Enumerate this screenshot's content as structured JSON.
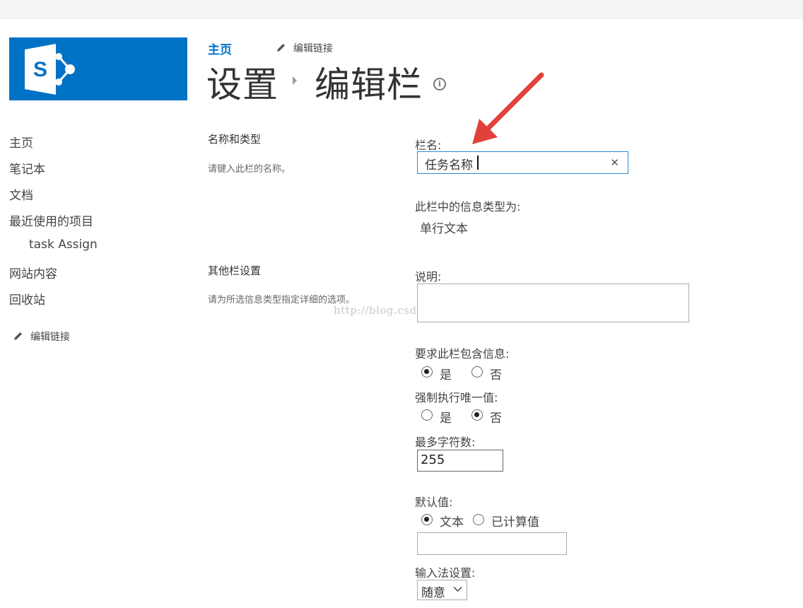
{
  "header": {
    "home_link": "主页",
    "edit_links": "编辑链接",
    "title_parent": "设置",
    "title_current": "编辑栏"
  },
  "logo": {
    "letter": "S"
  },
  "quick_launch": {
    "items": [
      "主页",
      "笔记本",
      "文档",
      "最近使用的项目",
      "task Assign",
      "网站内容",
      "回收站"
    ],
    "edit_links": "编辑链接"
  },
  "sections": {
    "name_type": {
      "title": "名称和类型",
      "description": "请键入此栏的名称。"
    },
    "additional": {
      "title": "其他栏设置",
      "description": "请为所选信息类型指定详细的选项。"
    }
  },
  "watermark": "http://blog.csdn.net/",
  "form": {
    "column_name": {
      "label": "栏名:",
      "value": "任务名称"
    },
    "type": {
      "label": "此栏中的信息类型为:",
      "value": "单行文本"
    },
    "description": {
      "label": "说明:",
      "value": ""
    },
    "require": {
      "label": "要求此栏包含信息:",
      "yes": "是",
      "no": "否",
      "selected": "yes"
    },
    "unique": {
      "label": "强制执行唯一值:",
      "yes": "是",
      "no": "否",
      "selected": "no"
    },
    "max_chars": {
      "label": "最多字符数:",
      "value": "255"
    },
    "default_value": {
      "label": "默认值:",
      "opt_text": "文本",
      "opt_calc": "已计算值",
      "selected": "text",
      "value": ""
    },
    "ime": {
      "label": "输入法设置:",
      "value": "随意"
    }
  },
  "colors": {
    "brand": "#0072c6",
    "accent": "#2a8dd4",
    "annotation": "#e2403a"
  }
}
